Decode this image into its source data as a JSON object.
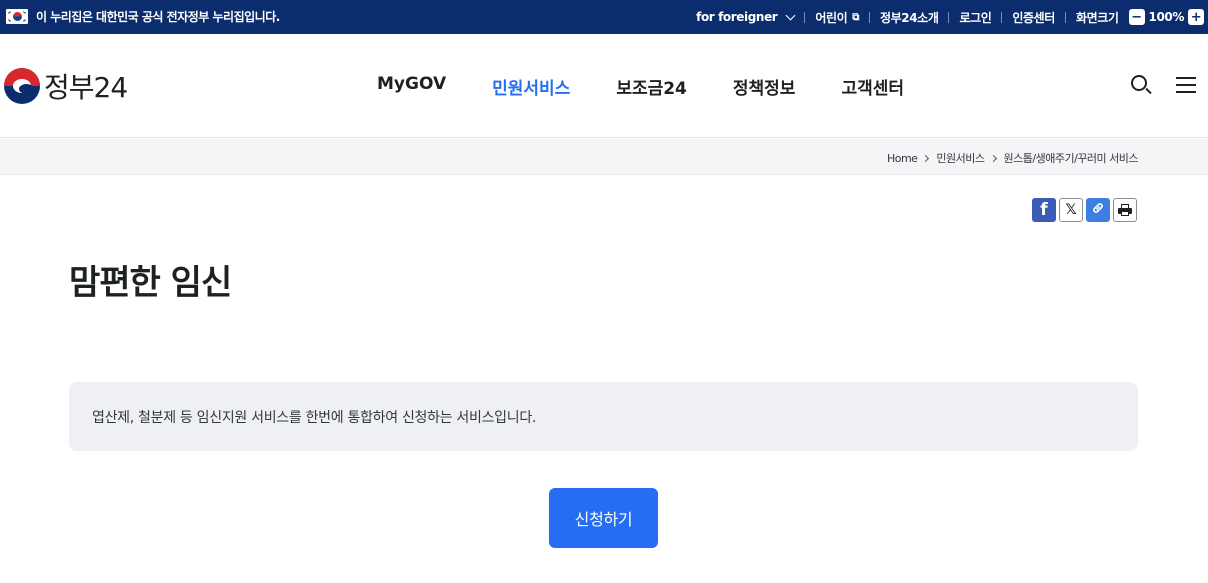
{
  "gov_bar": {
    "official_notice": "이 누리집은 대한민국 공식 전자정부 누리집입니다.",
    "foreigner": "for foreigner",
    "kids": "어린이",
    "about": "정부24소개",
    "login": "로그인",
    "cert_center": "인증센터",
    "zoom_label": "화면크기",
    "zoom_minus": "−",
    "zoom_value": "100%",
    "zoom_plus": "+"
  },
  "header": {
    "logo_text": "정부24",
    "nav": [
      {
        "label": "MyGOV",
        "active": false
      },
      {
        "label": "민원서비스",
        "active": true
      },
      {
        "label": "보조금24",
        "active": false
      },
      {
        "label": "정책정보",
        "active": false
      },
      {
        "label": "고객센터",
        "active": false
      }
    ],
    "icons": [
      "search-icon",
      "menu-icon"
    ]
  },
  "breadcrumb": {
    "home": "Home",
    "level1": "민원서비스",
    "level2": "원스톱/생애주기/꾸러미 서비스"
  },
  "share": {
    "facebook_glyph": "f",
    "x_glyph": "𝕏",
    "link_glyph": "🔗"
  },
  "page": {
    "title": "맘편한 임신",
    "description": "엽산제, 철분제 등 임신지원 서비스를 한번에 통합하여 신청하는 서비스입니다.",
    "apply_label": "신청하기"
  },
  "colors": {
    "gov_bar_bg": "#0b2d6e",
    "accent": "#256ef4",
    "desc_bg": "#eef0f4",
    "breadcrumb_bg": "#f4f5f6"
  }
}
